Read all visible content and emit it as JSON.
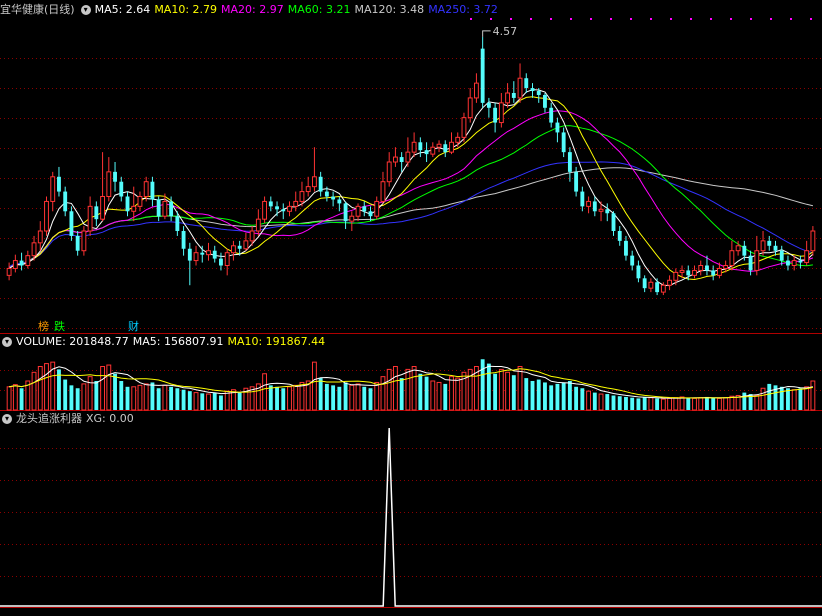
{
  "header": {
    "stock_title": "宜华健康(日线)",
    "ma_items": [
      {
        "label": "MA5: 2.64",
        "color": "#ffffff"
      },
      {
        "label": "MA10: 2.79",
        "color": "#ffff00"
      },
      {
        "label": "MA20: 2.97",
        "color": "#ff00ff"
      },
      {
        "label": "MA60: 3.21",
        "color": "#00ff00"
      },
      {
        "label": "MA120: 3.48",
        "color": "#c8c8c8"
      },
      {
        "label": "MA250: 3.72",
        "color": "#3333ff"
      }
    ]
  },
  "volume_header": {
    "items": [
      {
        "label": "VOLUME: 201848.77",
        "color": "#ffffff"
      },
      {
        "label": "MA5: 156807.91",
        "color": "#ffffff"
      },
      {
        "label": "MA10: 191867.44",
        "color": "#ffff00"
      }
    ]
  },
  "indicator_header": {
    "name": "龙头追涨利器",
    "value": "XG: 0.00"
  },
  "badges": [
    {
      "text": "榜",
      "color": "#ff9900"
    },
    {
      "text": "跌",
      "color": "#00ff00"
    },
    {
      "text": "财",
      "color": "#00ccff"
    }
  ],
  "annotations": {
    "high_label": "4.57"
  },
  "colors": {
    "up": "#ff3333",
    "down": "#54fcfc",
    "grid": "#8b0000",
    "ma5": "#ffffff",
    "ma10": "#ffff00",
    "ma20": "#ff00ff",
    "ma60": "#00ff00",
    "ma120": "#c8c8c8",
    "ma250": "#3333ff",
    "vol_ma5": "#ffffff",
    "vol_ma10": "#ffff00",
    "signal": "#ffffff"
  },
  "chart_data": {
    "type": "candlestick",
    "price_range": [
      1.9,
      4.7
    ],
    "volume_range": [
      0,
      400000
    ],
    "signal_range": [
      0,
      1
    ],
    "signal_spike_index": 61,
    "high_marker_index": 76,
    "candles": [
      [
        2.15,
        2.22,
        2.1,
        2.28,
        1
      ],
      [
        2.22,
        2.3,
        2.18,
        2.36,
        1
      ],
      [
        2.3,
        2.25,
        2.2,
        2.38,
        0
      ],
      [
        2.25,
        2.35,
        2.22,
        2.4,
        1
      ],
      [
        2.35,
        2.48,
        2.3,
        2.55,
        1
      ],
      [
        2.48,
        2.6,
        2.4,
        2.7,
        1
      ],
      [
        2.6,
        2.9,
        2.55,
        2.95,
        1
      ],
      [
        2.9,
        3.15,
        2.8,
        3.2,
        1
      ],
      [
        3.15,
        3.0,
        2.95,
        3.25,
        0
      ],
      [
        3.0,
        2.8,
        2.75,
        3.05,
        0
      ],
      [
        2.8,
        2.55,
        2.5,
        2.85,
        0
      ],
      [
        2.55,
        2.4,
        2.35,
        2.6,
        0
      ],
      [
        2.4,
        2.6,
        2.35,
        2.65,
        1
      ],
      [
        2.6,
        2.85,
        2.55,
        2.95,
        1
      ],
      [
        2.85,
        2.72,
        2.65,
        2.9,
        0
      ],
      [
        2.72,
        2.95,
        2.7,
        3.4,
        1
      ],
      [
        2.95,
        3.2,
        2.9,
        3.35,
        1
      ],
      [
        3.2,
        3.1,
        3.0,
        3.3,
        0
      ],
      [
        3.1,
        2.95,
        2.9,
        3.15,
        0
      ],
      [
        2.95,
        2.8,
        2.75,
        3.0,
        0
      ],
      [
        2.8,
        2.85,
        2.7,
        3.05,
        1
      ],
      [
        2.85,
        2.95,
        2.8,
        3.0,
        1
      ],
      [
        2.95,
        3.1,
        2.9,
        3.15,
        1
      ],
      [
        3.1,
        2.92,
        2.85,
        3.15,
        0
      ],
      [
        2.92,
        2.75,
        2.7,
        2.95,
        0
      ],
      [
        2.75,
        2.9,
        2.72,
        2.98,
        1
      ],
      [
        2.9,
        2.75,
        2.7,
        2.95,
        0
      ],
      [
        2.75,
        2.6,
        2.55,
        2.8,
        0
      ],
      [
        2.6,
        2.42,
        2.35,
        2.65,
        0
      ],
      [
        2.42,
        2.3,
        2.05,
        2.48,
        0
      ],
      [
        2.3,
        2.38,
        2.25,
        2.45,
        1
      ],
      [
        2.38,
        2.36,
        2.28,
        2.45,
        0
      ],
      [
        2.36,
        2.4,
        2.3,
        2.48,
        1
      ],
      [
        2.4,
        2.32,
        2.28,
        2.45,
        0
      ],
      [
        2.32,
        2.25,
        2.2,
        2.38,
        0
      ],
      [
        2.25,
        2.38,
        2.15,
        2.42,
        1
      ],
      [
        2.38,
        2.45,
        2.3,
        2.5,
        1
      ],
      [
        2.45,
        2.42,
        2.35,
        2.5,
        0
      ],
      [
        2.42,
        2.5,
        2.4,
        2.58,
        1
      ],
      [
        2.5,
        2.6,
        2.45,
        2.65,
        1
      ],
      [
        2.6,
        2.72,
        2.55,
        2.82,
        1
      ],
      [
        2.72,
        2.9,
        2.68,
        2.95,
        1
      ],
      [
        2.9,
        2.85,
        2.8,
        2.95,
        0
      ],
      [
        2.85,
        2.82,
        2.75,
        2.9,
        0
      ],
      [
        2.82,
        2.8,
        2.72,
        2.88,
        0
      ],
      [
        2.8,
        2.85,
        2.75,
        2.9,
        1
      ],
      [
        2.85,
        2.9,
        2.8,
        3.0,
        1
      ],
      [
        2.9,
        3.0,
        2.85,
        3.1,
        1
      ],
      [
        3.0,
        3.05,
        2.95,
        3.15,
        1
      ],
      [
        3.05,
        3.15,
        3.0,
        3.45,
        1
      ],
      [
        3.15,
        3.0,
        2.95,
        3.2,
        0
      ],
      [
        3.0,
        2.95,
        2.9,
        3.05,
        0
      ],
      [
        2.95,
        2.92,
        2.85,
        3.0,
        0
      ],
      [
        2.92,
        2.88,
        2.8,
        2.95,
        0
      ],
      [
        2.88,
        2.7,
        2.62,
        2.9,
        0
      ],
      [
        2.7,
        2.75,
        2.6,
        2.8,
        1
      ],
      [
        2.75,
        2.85,
        2.7,
        2.88,
        1
      ],
      [
        2.85,
        2.8,
        2.75,
        2.9,
        0
      ],
      [
        2.8,
        2.75,
        2.7,
        2.85,
        0
      ],
      [
        2.75,
        2.9,
        2.72,
        2.95,
        1
      ],
      [
        2.9,
        3.1,
        2.88,
        3.2,
        1
      ],
      [
        3.1,
        3.3,
        3.05,
        3.4,
        1
      ],
      [
        3.3,
        3.35,
        3.25,
        3.45,
        1
      ],
      [
        3.35,
        3.3,
        3.2,
        3.4,
        0
      ],
      [
        3.3,
        3.4,
        3.25,
        3.55,
        1
      ],
      [
        3.4,
        3.5,
        3.35,
        3.6,
        1
      ],
      [
        3.5,
        3.42,
        3.35,
        3.55,
        0
      ],
      [
        3.42,
        3.38,
        3.3,
        3.5,
        0
      ],
      [
        3.38,
        3.45,
        3.35,
        3.5,
        1
      ],
      [
        3.45,
        3.48,
        3.4,
        3.52,
        1
      ],
      [
        3.48,
        3.4,
        3.35,
        3.52,
        0
      ],
      [
        3.4,
        3.5,
        3.38,
        3.6,
        1
      ],
      [
        3.5,
        3.55,
        3.45,
        3.6,
        1
      ],
      [
        3.55,
        3.75,
        3.5,
        3.8,
        1
      ],
      [
        3.75,
        3.95,
        3.7,
        4.05,
        1
      ],
      [
        3.95,
        4.1,
        3.9,
        4.2,
        1
      ],
      [
        4.45,
        3.9,
        3.85,
        4.57,
        0
      ],
      [
        3.9,
        3.85,
        3.75,
        3.95,
        0
      ],
      [
        3.85,
        3.7,
        3.6,
        3.9,
        0
      ],
      [
        3.7,
        3.9,
        3.65,
        4.0,
        1
      ],
      [
        3.9,
        4.0,
        3.85,
        4.1,
        1
      ],
      [
        4.0,
        3.95,
        3.9,
        4.12,
        0
      ],
      [
        3.95,
        4.15,
        3.9,
        4.3,
        1
      ],
      [
        4.15,
        4.05,
        4.0,
        4.2,
        0
      ],
      [
        4.05,
        4.02,
        3.95,
        4.1,
        0
      ],
      [
        4.02,
        3.98,
        3.9,
        4.05,
        0
      ],
      [
        3.98,
        3.85,
        3.8,
        4.0,
        0
      ],
      [
        3.85,
        3.7,
        3.65,
        3.9,
        0
      ],
      [
        3.7,
        3.6,
        3.5,
        3.75,
        0
      ],
      [
        3.6,
        3.4,
        3.35,
        3.65,
        0
      ],
      [
        3.4,
        3.2,
        3.1,
        3.45,
        0
      ],
      [
        3.2,
        3.0,
        2.95,
        3.25,
        0
      ],
      [
        3.0,
        2.85,
        2.8,
        3.05,
        0
      ],
      [
        2.85,
        2.9,
        2.78,
        2.95,
        1
      ],
      [
        2.9,
        2.8,
        2.75,
        2.95,
        0
      ],
      [
        2.8,
        2.82,
        2.7,
        2.9,
        1
      ],
      [
        2.82,
        2.78,
        2.7,
        2.88,
        0
      ],
      [
        2.78,
        2.6,
        2.55,
        2.8,
        0
      ],
      [
        2.6,
        2.5,
        2.45,
        2.65,
        0
      ],
      [
        2.5,
        2.35,
        2.3,
        2.55,
        0
      ],
      [
        2.35,
        2.25,
        2.2,
        2.4,
        0
      ],
      [
        2.25,
        2.12,
        2.08,
        2.3,
        0
      ],
      [
        2.12,
        2.02,
        1.98,
        2.15,
        0
      ],
      [
        2.02,
        2.08,
        1.98,
        2.12,
        1
      ],
      [
        2.08,
        1.98,
        1.95,
        2.12,
        0
      ],
      [
        1.98,
        2.05,
        1.95,
        2.08,
        1
      ],
      [
        2.05,
        2.1,
        2.0,
        2.15,
        1
      ],
      [
        2.1,
        2.18,
        2.05,
        2.22,
        1
      ],
      [
        2.18,
        2.2,
        2.12,
        2.25,
        1
      ],
      [
        2.2,
        2.15,
        2.1,
        2.25,
        0
      ],
      [
        2.15,
        2.2,
        2.12,
        2.25,
        1
      ],
      [
        2.2,
        2.25,
        2.15,
        2.3,
        1
      ],
      [
        2.25,
        2.2,
        2.15,
        2.35,
        0
      ],
      [
        2.2,
        2.15,
        2.1,
        2.25,
        0
      ],
      [
        2.15,
        2.22,
        2.12,
        2.28,
        1
      ],
      [
        2.22,
        2.25,
        2.18,
        2.3,
        1
      ],
      [
        2.25,
        2.4,
        2.2,
        2.5,
        1
      ],
      [
        2.4,
        2.45,
        2.35,
        2.5,
        1
      ],
      [
        2.45,
        2.35,
        2.3,
        2.5,
        0
      ],
      [
        2.35,
        2.2,
        2.15,
        2.4,
        0
      ],
      [
        2.2,
        2.4,
        2.15,
        2.55,
        1
      ],
      [
        2.4,
        2.5,
        2.35,
        2.6,
        1
      ],
      [
        2.5,
        2.45,
        2.4,
        2.55,
        0
      ],
      [
        2.45,
        2.4,
        2.35,
        2.5,
        0
      ],
      [
        2.4,
        2.3,
        2.25,
        2.45,
        0
      ],
      [
        2.3,
        2.25,
        2.2,
        2.35,
        0
      ],
      [
        2.25,
        2.3,
        2.2,
        2.35,
        1
      ],
      [
        2.3,
        2.28,
        2.22,
        2.35,
        0
      ],
      [
        2.28,
        2.4,
        2.25,
        2.5,
        1
      ],
      [
        2.4,
        2.6,
        2.35,
        2.65,
        1
      ]
    ],
    "volumes": [
      160000,
      175000,
      150000,
      200000,
      260000,
      300000,
      320000,
      330000,
      280000,
      210000,
      170000,
      150000,
      180000,
      230000,
      200000,
      300000,
      310000,
      250000,
      200000,
      160000,
      160000,
      170000,
      180000,
      190000,
      150000,
      170000,
      160000,
      150000,
      140000,
      130000,
      120000,
      115000,
      110000,
      120000,
      100000,
      130000,
      140000,
      120000,
      150000,
      160000,
      180000,
      250000,
      170000,
      160000,
      150000,
      160000,
      170000,
      190000,
      200000,
      330000,
      220000,
      180000,
      170000,
      160000,
      190000,
      170000,
      180000,
      160000,
      150000,
      190000,
      230000,
      280000,
      300000,
      220000,
      280000,
      300000,
      250000,
      230000,
      200000,
      190000,
      180000,
      230000,
      220000,
      260000,
      280000,
      300000,
      350000,
      320000,
      250000,
      280000,
      260000,
      240000,
      300000,
      220000,
      200000,
      210000,
      190000,
      170000,
      180000,
      190000,
      200000,
      160000,
      150000,
      130000,
      120000,
      110000,
      110000,
      100000,
      95000,
      90000,
      85000,
      80000,
      90000,
      85000,
      80000,
      75000,
      80000,
      85000,
      90000,
      85000,
      80000,
      85000,
      90000,
      85000,
      80000,
      85000,
      95000,
      100000,
      120000,
      110000,
      100000,
      150000,
      180000,
      170000,
      160000,
      150000,
      140000,
      150000,
      160000,
      200000
    ]
  }
}
